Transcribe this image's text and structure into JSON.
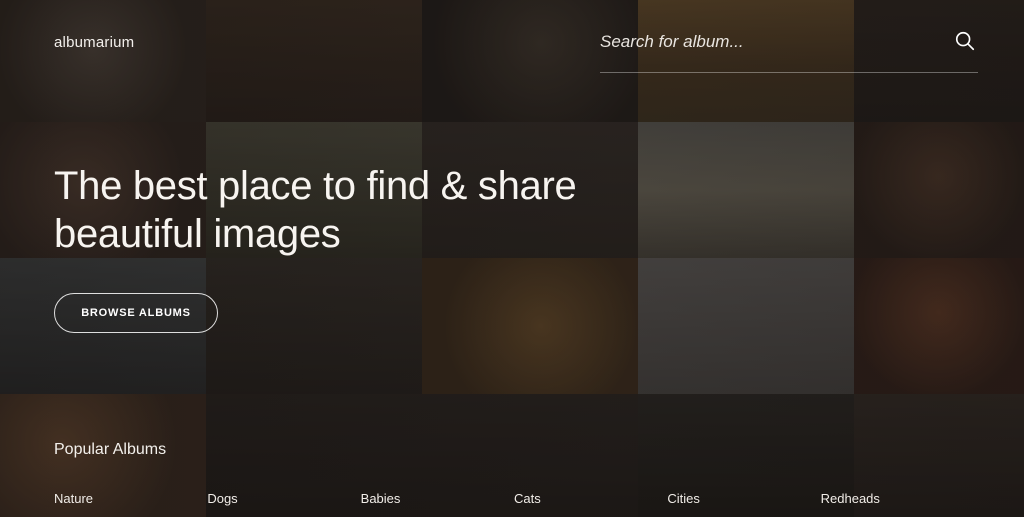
{
  "brand": {
    "name": "albumarium"
  },
  "search": {
    "placeholder": "Search for album..."
  },
  "hero": {
    "title_line1": "The best place to find & share",
    "title_line2": "beautiful images",
    "browse_label": "BROWSE ALBUMS"
  },
  "popular": {
    "title": "Popular Albums",
    "albums": [
      {
        "label": "Nature"
      },
      {
        "label": "Dogs"
      },
      {
        "label": "Babies"
      },
      {
        "label": "Cats"
      },
      {
        "label": "Cities"
      },
      {
        "label": "Redheads"
      }
    ]
  },
  "colors": {
    "background": "#1c1714",
    "text": "#ffffff",
    "tile_tints": [
      "#5a4a3e",
      "#4a3b2d",
      "#3a302a",
      "#6a5434",
      "#3c302a",
      "#5a4838",
      "#4a4a3a",
      "#3d3630",
      "#6d6a5e",
      "#4d3a2e",
      "#3d4448",
      "#3e3a34",
      "#6a5436",
      "#6a6866",
      "#5a3a2a",
      "#7a5a40",
      "#3a3430",
      "#38332e",
      "#2f2a26",
      "#3d3430"
    ]
  }
}
